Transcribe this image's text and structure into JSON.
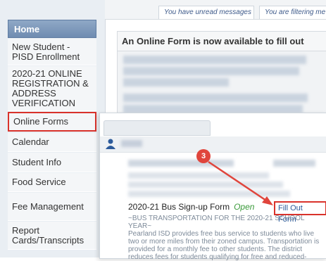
{
  "header": {
    "tabs": [
      "You have unread messages",
      "You are filtering me"
    ]
  },
  "sidebar": {
    "home": "Home",
    "items": [
      {
        "label": "New Student - PISD Enrollment"
      },
      {
        "label": "2020-21 ONLINE REGISTRATION & ADDRESS VERIFICATION"
      },
      {
        "label": "Online Forms"
      },
      {
        "label": "Calendar"
      },
      {
        "label": "Student Info"
      },
      {
        "label": "Food Service"
      },
      {
        "label": "Fee Management"
      },
      {
        "label": "Report Cards/Transcripts"
      }
    ]
  },
  "main": {
    "panel_title": "An Online Form is now available to fill out"
  },
  "popup": {
    "form_title": "2020-21 Bus Sign-up Form",
    "form_status": "Open",
    "fill_button": "Fill Out Form",
    "description_lines": [
      "~BUS TRANSPORTATION FOR THE 2020-21 SCHOOL YEAR~",
      "Pearland ISD provides free bus service to students who live",
      "two or more miles from their zoned campus. Transportation is",
      "provided for a monthly fee to other students. The district",
      "reduces fees for students qualifying for free and reduced-"
    ]
  },
  "annotation": {
    "step_number": "3"
  },
  "colors": {
    "highlight": "#d9322b",
    "home_bg": "#7d98bb",
    "open_status": "#3a9a3a",
    "link": "#2d5b9b"
  }
}
